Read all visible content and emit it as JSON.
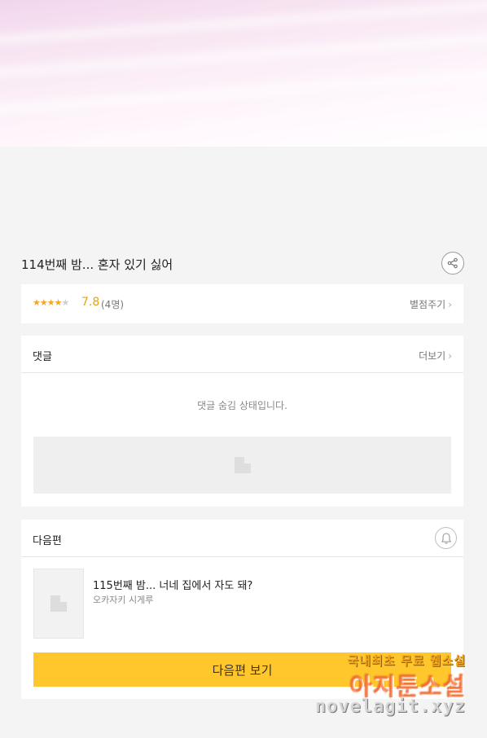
{
  "episode": {
    "title": "114번째 밤... 혼자 있기 싫어"
  },
  "rating": {
    "stars_filled": 4,
    "stars_total": 5,
    "score": "7.8",
    "count": "(4명)",
    "rate_link": "별점주기"
  },
  "comments": {
    "header": "댓글",
    "more_link": "더보기",
    "hidden_message": "댓글 숨김 상태입니다."
  },
  "next_episode": {
    "header": "다음편",
    "title": "115번째 밤... 너네 집에서 자도 돼?",
    "author": "오카자키 시게루",
    "button_label": "다음편 보기"
  },
  "watermark": {
    "line1": "국내최초 무료 웹소설",
    "line2": "아지툰소설",
    "line3": "novelagit.xyz"
  },
  "icons": {
    "share": "share-icon",
    "chevron": "chevron-right-icon",
    "bell": "bell-icon",
    "image_placeholder": "image-placeholder-icon"
  },
  "colors": {
    "accent_star": "#f5a623",
    "score": "#f0a000",
    "next_button": "#ffc72c"
  }
}
